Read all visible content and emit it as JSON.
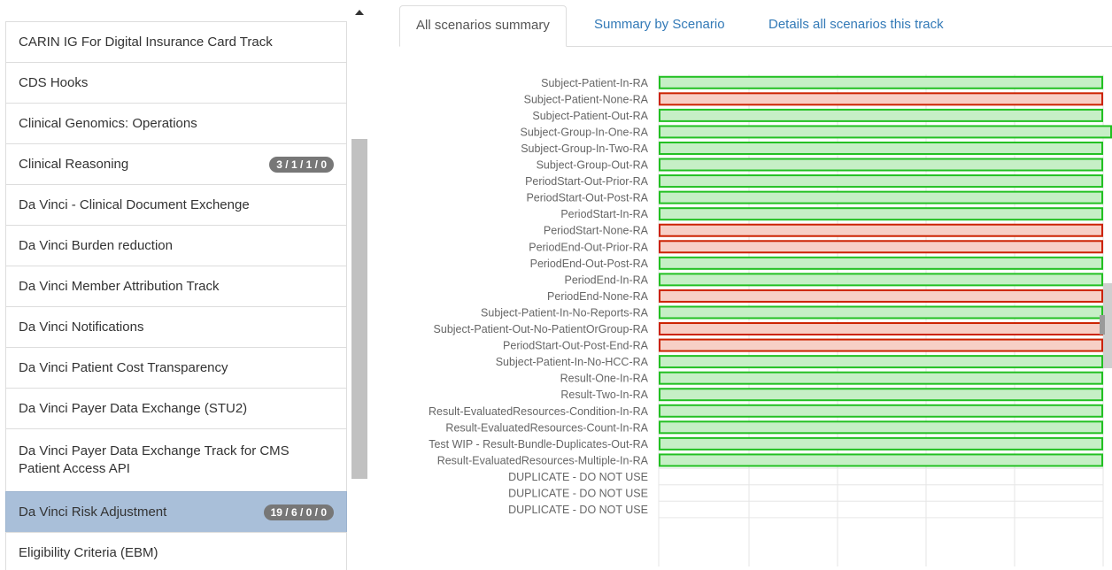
{
  "sidebar": {
    "items": [
      {
        "label": "CARIN IG For Digital Insurance Card Track",
        "badge": "",
        "active": false
      },
      {
        "label": "CDS Hooks",
        "badge": "",
        "active": false
      },
      {
        "label": "Clinical Genomics: Operations",
        "badge": "",
        "active": false
      },
      {
        "label": "Clinical Reasoning",
        "badge": "3 / 1 / 1 / 0",
        "active": false
      },
      {
        "label": "Da Vinci - Clinical Document Exchenge",
        "badge": "",
        "active": false
      },
      {
        "label": "Da Vinci Burden reduction",
        "badge": "",
        "active": false
      },
      {
        "label": "Da Vinci Member Attribution Track",
        "badge": "",
        "active": false
      },
      {
        "label": "Da Vinci Notifications",
        "badge": "",
        "active": false
      },
      {
        "label": "Da Vinci Patient Cost Transparency",
        "badge": "",
        "active": false
      },
      {
        "label": "Da Vinci Payer Data Exchange (STU2)",
        "badge": "",
        "active": false
      },
      {
        "label": "Da Vinci Payer Data Exchange Track for CMS Patient Access API",
        "badge": "",
        "active": false
      },
      {
        "label": "Da Vinci Risk Adjustment",
        "badge": "19 / 6 / 0 / 0",
        "active": true
      },
      {
        "label": "Eligibility Criteria (EBM)",
        "badge": "",
        "active": false
      }
    ]
  },
  "tabs": [
    {
      "label": "All scenarios summary",
      "active": true
    },
    {
      "label": "Summary by Scenario",
      "active": false
    },
    {
      "label": "Details all scenarios this track",
      "active": false
    }
  ],
  "colors": {
    "pass_fill": "#c6efc6",
    "pass_stroke": "#22c022",
    "fail_fill": "#f7cfc6",
    "fail_stroke": "#cc2200",
    "grid": "#e6e6e6",
    "active_item": "#a9bfd9",
    "badge": "#777777",
    "link": "#337ab7"
  },
  "chart_data": {
    "type": "bar",
    "orientation": "horizontal",
    "categories": [
      "Subject-Patient-In-RA",
      "Subject-Patient-None-RA",
      "Subject-Patient-Out-RA",
      "Subject-Group-In-One-RA",
      "Subject-Group-In-Two-RA",
      "Subject-Group-Out-RA",
      "PeriodStart-Out-Prior-RA",
      "PeriodStart-Out-Post-RA",
      "PeriodStart-In-RA",
      "PeriodStart-None-RA",
      "PeriodEnd-Out-Prior-RA",
      "PeriodEnd-Out-Post-RA",
      "PeriodEnd-In-RA",
      "PeriodEnd-None-RA",
      "Subject-Patient-In-No-Reports-RA",
      "Subject-Patient-Out-No-PatientOrGroup-RA",
      "PeriodStart-Out-Post-End-RA",
      "Subject-Patient-In-No-HCC-RA",
      "Result-One-In-RA",
      "Result-Two-In-RA",
      "Result-EvaluatedResources-Condition-In-RA",
      "Result-EvaluatedResources-Count-In-RA",
      "Test WIP - Result-Bundle-Duplicates-Out-RA",
      "Result-EvaluatedResources-Multiple-In-RA",
      "DUPLICATE - DO NOT USE",
      "DUPLICATE - DO NOT USE",
      "DUPLICATE - DO NOT USE"
    ],
    "values": [
      1,
      1,
      1,
      1,
      1,
      1,
      1,
      1,
      1,
      1,
      1,
      1,
      1,
      1,
      1,
      1,
      1,
      1,
      1,
      1,
      1,
      1,
      1,
      1,
      0,
      0,
      0
    ],
    "status": [
      "pass",
      "fail",
      "pass",
      "pass",
      "pass",
      "pass",
      "pass",
      "pass",
      "pass",
      "fail",
      "fail",
      "pass",
      "pass",
      "fail",
      "pass",
      "fail",
      "fail",
      "pass",
      "pass",
      "pass",
      "pass",
      "pass",
      "pass",
      "pass",
      "none",
      "none",
      "none"
    ],
    "extended": [
      false,
      false,
      false,
      true,
      false,
      false,
      false,
      false,
      false,
      false,
      false,
      false,
      false,
      false,
      false,
      false,
      false,
      false,
      false,
      false,
      false,
      false,
      false,
      false,
      false,
      false,
      false
    ],
    "grid": true,
    "xlim": [
      0,
      1
    ]
  }
}
